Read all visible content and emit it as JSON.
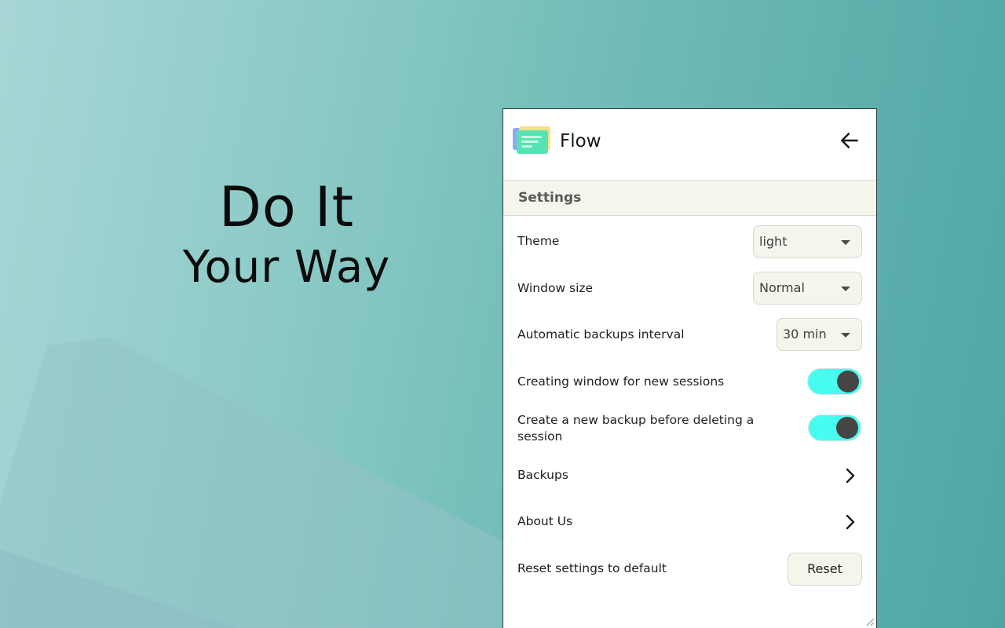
{
  "hero": {
    "line1": "Do It",
    "line2": "Your Way"
  },
  "app": {
    "title": "Flow",
    "logo_icon": "stacked-cards-logo",
    "back_icon": "arrow-left-icon"
  },
  "settings": {
    "section_title": "Settings",
    "theme": {
      "label": "Theme",
      "value": "light"
    },
    "window_size": {
      "label": "Window size",
      "value": "Normal"
    },
    "backup_interval": {
      "label": "Automatic backups interval",
      "value": "30 min"
    },
    "new_window_sessions": {
      "label": "Creating window for new sessions",
      "enabled": true
    },
    "backup_before_delete": {
      "label": "Create a new backup before deleting a session",
      "enabled": true
    },
    "backups": {
      "label": "Backups"
    },
    "about_us": {
      "label": "About Us"
    },
    "reset": {
      "label": "Reset settings to default",
      "button": "Reset"
    }
  },
  "colors": {
    "toggle_on": "#48fdf0",
    "knob": "#454545",
    "select_bg": "#f6f5ec"
  }
}
